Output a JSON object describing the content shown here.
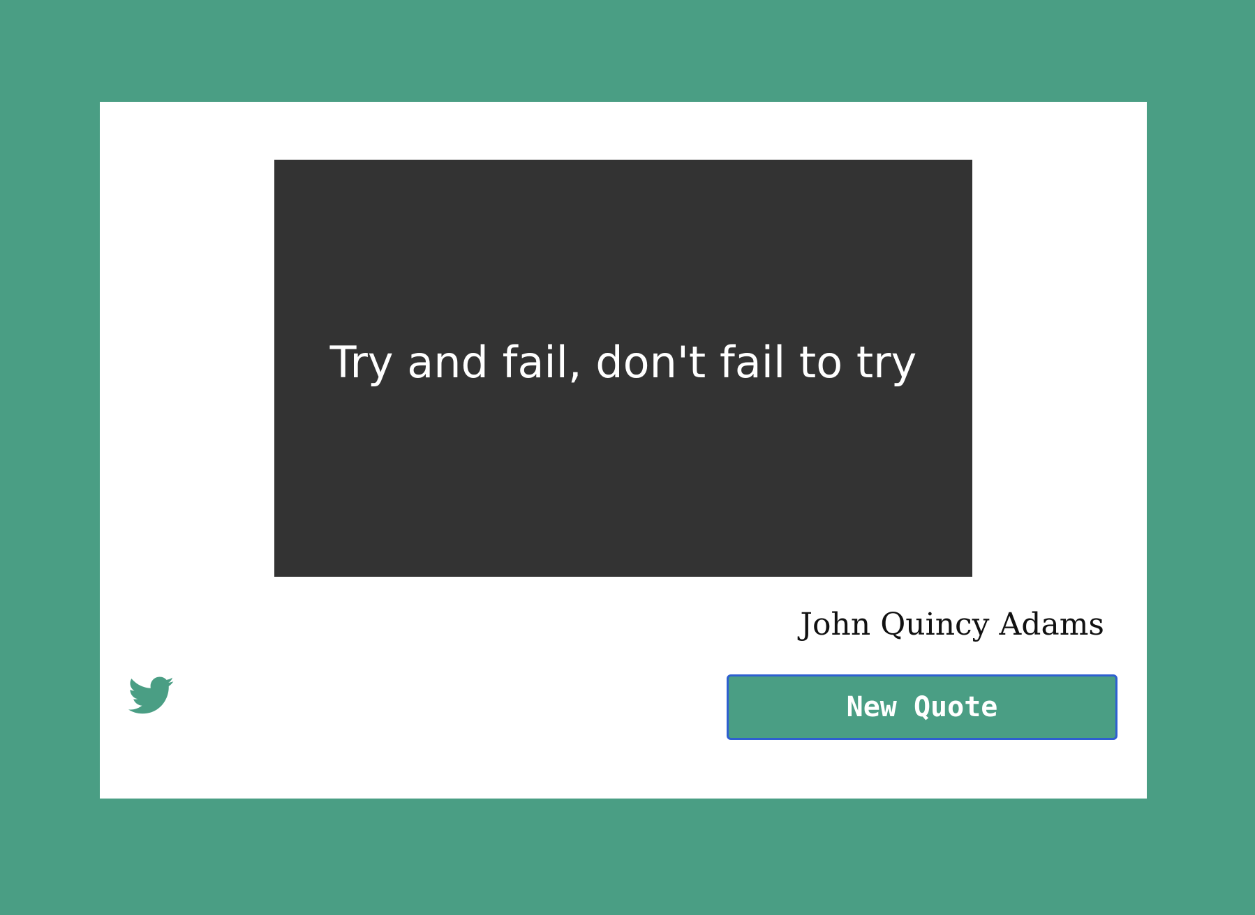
{
  "colors": {
    "background": "#4a9e84",
    "card": "#ffffff",
    "quote_box": "#333333",
    "quote_text": "#ffffff",
    "button": "#4a9e84",
    "button_border": "#2e5fd0",
    "icon": "#4a9e84"
  },
  "quote": {
    "text": "Try and fail, don't fail to try",
    "author": "John Quincy Adams"
  },
  "actions": {
    "tweet_icon": "twitter-icon",
    "new_quote_label": "New Quote"
  }
}
